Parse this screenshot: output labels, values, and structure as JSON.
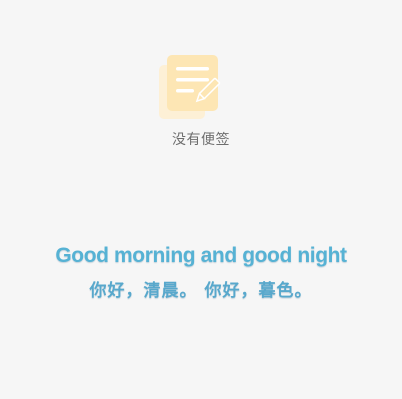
{
  "empty_state": {
    "icon": "note-pencil-icon",
    "label": "没有便签"
  },
  "quote": {
    "english": "Good morning and good night",
    "chinese": "你好，清晨。 你好，暮色。"
  },
  "colors": {
    "background": "#f6f6f6",
    "icon_fill": "#fde8b8",
    "icon_shadow": "#fdf0d6",
    "quote_text": "#56b2d4",
    "label_text": "#6e6e6e"
  }
}
